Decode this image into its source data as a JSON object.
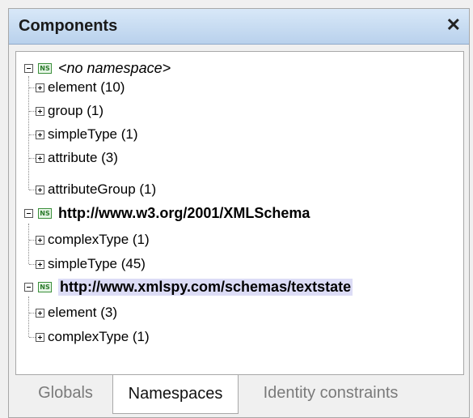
{
  "panel": {
    "title": "Components",
    "close_glyph": "✕"
  },
  "tree": {
    "namespaces": [
      {
        "label": "<no namespace>",
        "icon_text": "NS",
        "children": [
          {
            "label": "element (10)"
          },
          {
            "label": "group (1)"
          },
          {
            "label": "simpleType (1)"
          },
          {
            "label": "attribute (3)"
          },
          {
            "label": "attributeGroup (1)"
          }
        ]
      },
      {
        "label": "http://www.w3.org/2001/XMLSchema",
        "icon_text": "NS",
        "children": [
          {
            "label": "complexType (1)"
          },
          {
            "label": "simpleType (45)"
          }
        ]
      },
      {
        "label": "http://www.xmlspy.com/schemas/textstate",
        "icon_text": "NS",
        "children": [
          {
            "label": "element (3)"
          },
          {
            "label": "complexType (1)"
          }
        ]
      }
    ]
  },
  "tabs": [
    {
      "label": "Globals",
      "active": false
    },
    {
      "label": "Namespaces",
      "active": true
    },
    {
      "label": "Identity constraints",
      "active": false
    }
  ],
  "colors": {
    "titlebar": "#c3d8f0",
    "ns_icon_border": "#3b8f3b",
    "selection": "#dcdcf6",
    "inactive_tab_text": "#7a7a7a"
  }
}
